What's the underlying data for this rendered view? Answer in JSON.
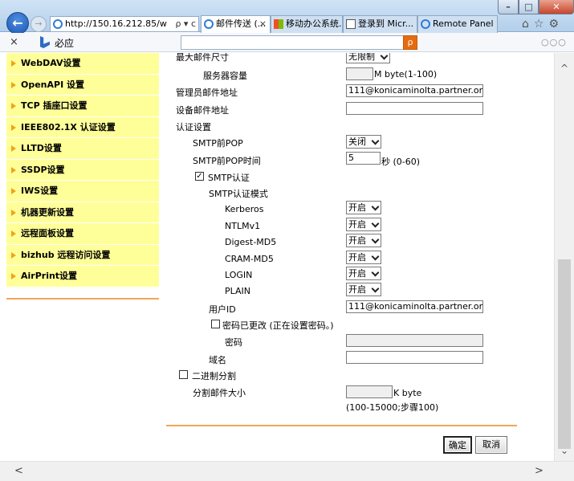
{
  "browser": {
    "window_controls": {
      "minimize": "–",
      "maximize": "□",
      "close": "✕"
    },
    "back_icon": "back-arrow-icon",
    "address": {
      "url": "http://150.16.212.85/w",
      "controls": "ρ ▾ c"
    },
    "tabs": [
      {
        "label": "邮件传送 (...",
        "close": "×",
        "icon": "ie-icon"
      },
      {
        "label": "移动办公系统...",
        "icon": "ms-icon"
      },
      {
        "label": "登录到 Micr...",
        "icon": "kc-icon"
      },
      {
        "label": "Remote Panel",
        "icon": "ie-icon"
      }
    ],
    "toolbar_icons": "⌂☆⚙"
  },
  "favbar": {
    "close": "×",
    "label": "必应",
    "search_icon": "ρ",
    "more": "○○○"
  },
  "sidebar": {
    "items": [
      {
        "label": "WebDAV设置"
      },
      {
        "label": "OpenAPI 设置"
      },
      {
        "label": "TCP 插座口设置"
      },
      {
        "label": "IEEE802.1X 认证设置"
      },
      {
        "label": "LLTD设置"
      },
      {
        "label": "SSDP设置"
      },
      {
        "label": "IWS设置"
      },
      {
        "label": "机器更新设置"
      },
      {
        "label": "远程面板设置"
      },
      {
        "label": "bizhub 远程访问设置"
      },
      {
        "label": "AirPrint设置"
      }
    ]
  },
  "form": {
    "max_mail_size_label": "最大邮件尺寸",
    "max_mail_size_value": "无限制",
    "server_capacity_label": "服务器容量",
    "server_capacity_unit": "M byte(1-100)",
    "admin_email_label": "管理员邮件地址",
    "admin_email_value": "111@konicaminolta.partner.onmsc",
    "device_email_label": "设备邮件地址",
    "device_email_value": "",
    "auth_settings_label": "认证设置",
    "pop_before_smtp_label": "SMTP前POP",
    "pop_before_smtp_value": "关闭",
    "pop_time_label": "SMTP前POP时间",
    "pop_time_value": "5",
    "pop_time_unit": "秒 (0-60)",
    "smtp_auth_checked": "✓",
    "smtp_auth_label": "SMTP认证",
    "smtp_auth_mode_label": "SMTP认证模式",
    "auth_modes": [
      {
        "label": "Kerberos",
        "value": "开启"
      },
      {
        "label": "NTLMv1",
        "value": "开启"
      },
      {
        "label": "Digest-MD5",
        "value": "开启"
      },
      {
        "label": "CRAM-MD5",
        "value": "开启"
      },
      {
        "label": "LOGIN",
        "value": "开启"
      },
      {
        "label": "PLAIN",
        "value": "开启"
      }
    ],
    "user_id_label": "用户ID",
    "user_id_value": "111@konicaminolta.partner.onmsc",
    "password_changed_label": "密码已更改 (正在设置密码。)",
    "password_label": "密码",
    "domain_label": "域名",
    "domain_value": "",
    "binary_split_label": "二进制分割",
    "split_size_label": "分割邮件大小",
    "split_size_unit": "K byte",
    "split_size_range": "(100-15000;步骤100)",
    "ok_button": "确定",
    "cancel_button": "取消"
  },
  "scrollbars": {
    "up": "^",
    "down": "⌄",
    "left": "<",
    "right": ">"
  }
}
